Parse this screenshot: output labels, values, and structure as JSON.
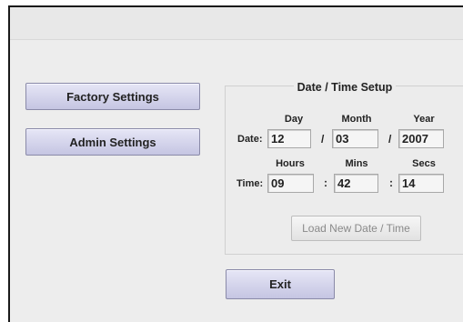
{
  "sidebar": {
    "factory_label": "Factory Settings",
    "admin_label": "Admin Settings"
  },
  "panel": {
    "title": "Date / Time Setup"
  },
  "date": {
    "row_label": "Date:",
    "day_header": "Day",
    "month_header": "Month",
    "year_header": "Year",
    "day": "12",
    "month": "03",
    "year": "2007",
    "separator": "/"
  },
  "time": {
    "row_label": "Time:",
    "hours_header": "Hours",
    "mins_header": "Mins",
    "secs_header": "Secs",
    "hours": "09",
    "mins": "42",
    "secs": "14",
    "separator": ":"
  },
  "actions": {
    "load_label": "Load New Date / Time",
    "exit_label": "Exit"
  }
}
